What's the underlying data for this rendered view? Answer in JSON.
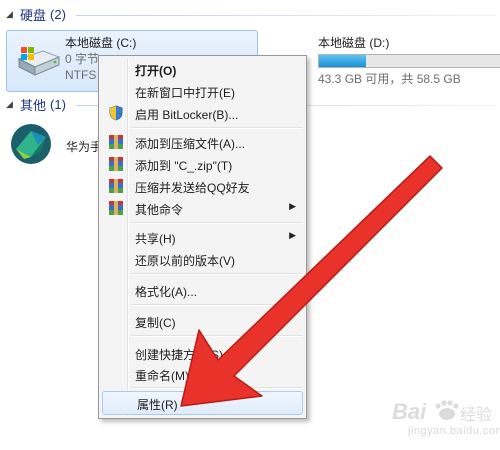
{
  "groups": {
    "drives": {
      "name": "硬盘",
      "count": "(2)"
    },
    "other": {
      "name": "其他",
      "count": "(1)"
    }
  },
  "drive_c": {
    "title": "本地磁盘 (C:)",
    "size": "0 字节",
    "fs": "NTFS",
    "icon": "hard-drive-icon"
  },
  "drive_d": {
    "title": "本地磁盘 (D:)",
    "free_text": "43.3 GB 可用，共 58.5 GB",
    "used_fraction": 0.26,
    "bar_color": "#1b8fd4"
  },
  "app": {
    "label": "华为手",
    "icon": "huawei-suite-icon"
  },
  "context_menu": {
    "items": [
      {
        "label": "打开(O)",
        "bold": true
      },
      {
        "label": "在新窗口中打开(E)"
      },
      {
        "label": "启用 BitLocker(B)...",
        "icon": "shield-icon"
      },
      {
        "label": "添加到压缩文件(A)...",
        "icon": "archive-icon"
      },
      {
        "label": "添加到 \"C_.zip\"(T)",
        "icon": "archive-icon"
      },
      {
        "label": "压缩并发送给QQ好友",
        "icon": "archive-icon"
      },
      {
        "label": "其他命令",
        "icon": "archive-icon",
        "submenu": "▶"
      },
      {
        "label": "共享(H)",
        "submenu": "▶"
      },
      {
        "label": "还原以前的版本(V)"
      },
      {
        "label": "格式化(A)..."
      },
      {
        "label": "复制(C)"
      },
      {
        "label": "创建快捷方式(S)"
      },
      {
        "label": "重命名(M)"
      },
      {
        "label": "属性(R)",
        "highlighted": true
      }
    ]
  },
  "annotation": {
    "color": "#e8322a"
  },
  "watermark": {
    "brand": "Bai 经验",
    "url": "jingyan.baidu.com"
  }
}
